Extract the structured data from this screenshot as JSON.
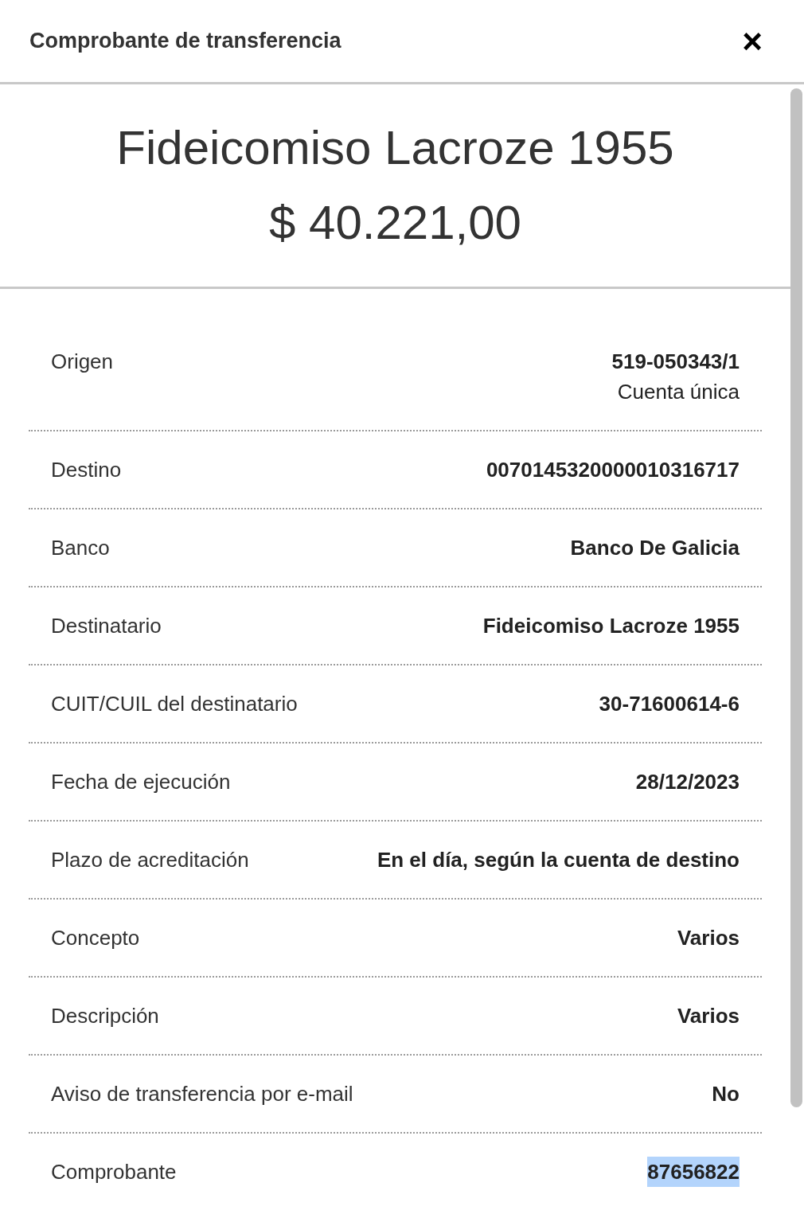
{
  "dialog": {
    "title": "Comprobante de transferencia",
    "close": "×"
  },
  "summary": {
    "recipient": "Fideicomiso Lacroze 1955",
    "amount": "$ 40.221,00"
  },
  "details": [
    {
      "label": "Origen",
      "values": [
        "519-050343/1",
        "Cuenta única"
      ],
      "highlighted": false
    },
    {
      "label": "Destino",
      "values": [
        "0070145320000010316717"
      ],
      "highlighted": false
    },
    {
      "label": "Banco",
      "values": [
        "Banco De Galicia"
      ],
      "highlighted": false
    },
    {
      "label": "Destinatario",
      "values": [
        "Fideicomiso Lacroze 1955"
      ],
      "highlighted": false
    },
    {
      "label": "CUIT/CUIL del destinatario",
      "values": [
        "30-71600614-6"
      ],
      "highlighted": false
    },
    {
      "label": "Fecha de ejecución",
      "values": [
        "28/12/2023"
      ],
      "highlighted": false
    },
    {
      "label": "Plazo de acreditación",
      "values": [
        "En el día, según la cuenta de destino"
      ],
      "highlighted": false
    },
    {
      "label": "Concepto",
      "values": [
        "Varios"
      ],
      "highlighted": false
    },
    {
      "label": "Descripción",
      "values": [
        "Varios"
      ],
      "highlighted": false
    },
    {
      "label": "Aviso de transferencia por e-mail",
      "values": [
        "No"
      ],
      "highlighted": false
    },
    {
      "label": "Comprobante",
      "values": [
        "87656822"
      ],
      "highlighted": true
    }
  ]
}
